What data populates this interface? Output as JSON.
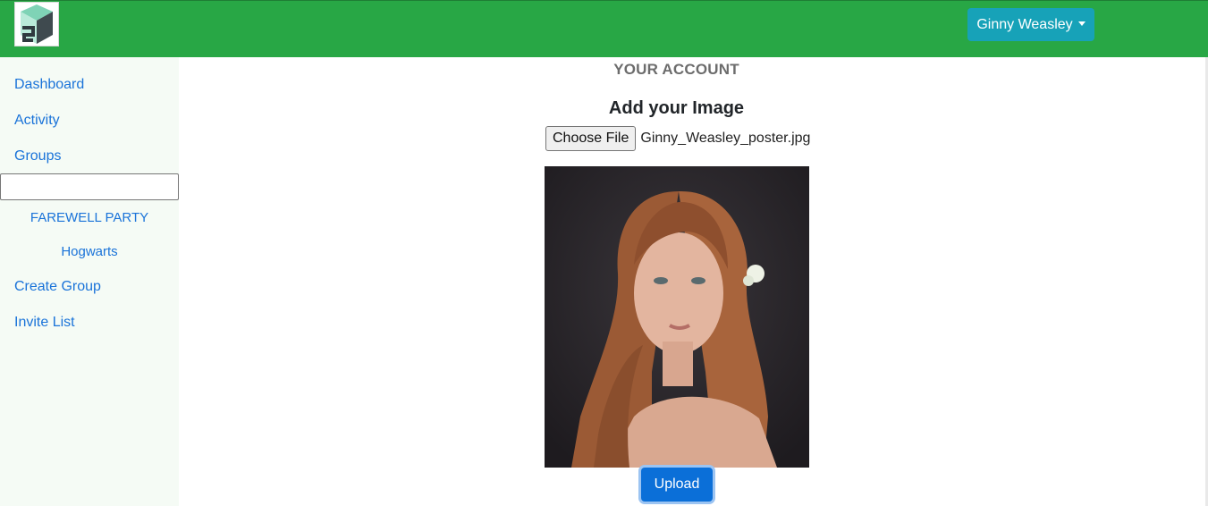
{
  "header": {
    "user_menu_label": "Ginny Weasley",
    "logo_icon": "app-logo-icon",
    "brand_color": "#28a745",
    "user_button_color": "#17a2b8"
  },
  "sidebar": {
    "items": [
      {
        "label": "Dashboard"
      },
      {
        "label": "Activity"
      },
      {
        "label": "Groups"
      }
    ],
    "search_value": "",
    "groups": [
      "FAREWELL PARTY",
      "Hogwarts"
    ],
    "footer_items": [
      {
        "label": "Create Group"
      },
      {
        "label": "Invite List"
      }
    ]
  },
  "main": {
    "title": "YOUR ACCOUNT",
    "subtitle": "Add your Image",
    "file_button_label": "Choose File",
    "file_name": "Ginny_Weasley_poster.jpg",
    "upload_label": "Upload",
    "upload_color": "#0b6fd8"
  }
}
